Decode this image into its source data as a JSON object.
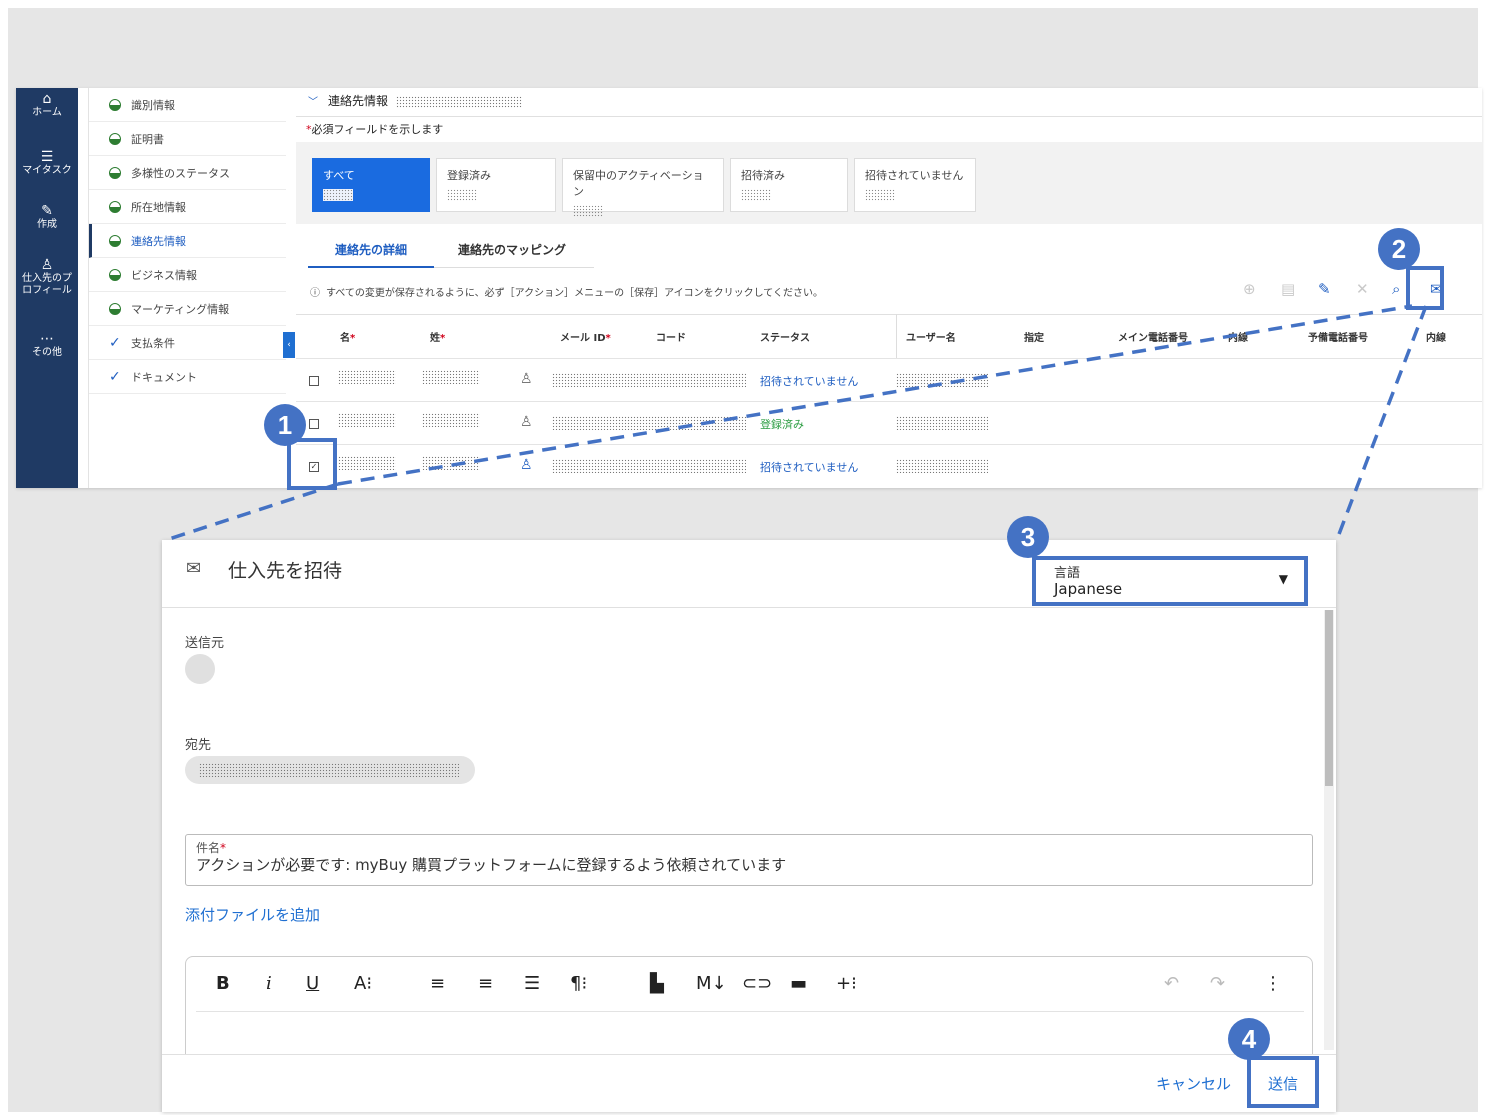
{
  "nav": {
    "items": [
      {
        "icon": "home-icon",
        "glyph": "⌂",
        "label": "ホーム"
      },
      {
        "icon": "task-list-icon",
        "glyph": "≡",
        "label": "マイタスク"
      },
      {
        "icon": "edit-icon",
        "glyph": "✎",
        "label": "作成"
      },
      {
        "icon": "supplier-profile-icon",
        "glyph": "♙",
        "label": "仕入先のプロフィール"
      },
      {
        "icon": "more-icon",
        "glyph": "…",
        "label": "その他"
      }
    ]
  },
  "sections": [
    {
      "label": "識別情報",
      "state": "partial"
    },
    {
      "label": "証明書",
      "state": "partial"
    },
    {
      "label": "多様性のステータス",
      "state": "partial"
    },
    {
      "label": "所在地情報",
      "state": "partial"
    },
    {
      "label": "連絡先情報",
      "state": "partial"
    },
    {
      "label": "ビジネス情報",
      "state": "partial"
    },
    {
      "label": "マーケティング情報",
      "state": "partial"
    },
    {
      "label": "支払条件",
      "state": "done"
    },
    {
      "label": "ドキュメント",
      "state": "done"
    }
  ],
  "contact": {
    "section_title": "連絡先情報",
    "required_note": "必須フィールドを示します",
    "cards": [
      "すべて",
      "登録済み",
      "保留中のアクティベーション",
      "招待済み",
      "招待されていません"
    ],
    "tabs": [
      "連絡先の詳細",
      "連絡先のマッピング"
    ],
    "info": "すべての変更が保存されるように、必ず［アクション］メニューの［保存］アイコンをクリックしてください。",
    "columns": [
      "名",
      "姓",
      "メール ID",
      "コード",
      "ステータス",
      "ユーザー名",
      "指定",
      "メイン電話番号",
      "内線",
      "予備電話番号",
      "内線"
    ],
    "rows": [
      {
        "checked": false,
        "status": "招待されていません",
        "status_color": "#1f5ec1"
      },
      {
        "checked": false,
        "status": "登録済み",
        "status_color": "#2e9e44"
      },
      {
        "checked": true,
        "status": "招待されていません",
        "status_color": "#1f5ec1"
      }
    ]
  },
  "dialog": {
    "title": "仕入先を招待",
    "language_label": "言語",
    "language_value": "Japanese",
    "from_label": "送信元",
    "to_label": "宛先",
    "subject_label": "件名",
    "subject_value": "アクションが必要です: myBuy 購買プラットフォームに登録するよう依頼されています",
    "attach_label": "添付ファイルを追加",
    "cancel_label": "キャンセル",
    "send_label": "送信"
  },
  "annotations": [
    "1",
    "2",
    "3",
    "4"
  ],
  "colors": {
    "accent": "#4472c4",
    "nav": "#1f3a64",
    "link": "#1f6fd1"
  }
}
